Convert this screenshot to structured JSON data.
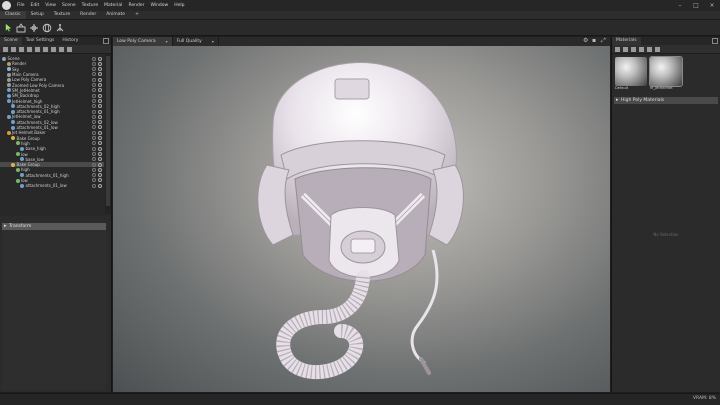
{
  "menu": [
    "File",
    "Edit",
    "View",
    "Scene",
    "Texture",
    "Material",
    "Render",
    "Window",
    "Help"
  ],
  "workspace_tabs": [
    {
      "label": "Classic",
      "active": true
    },
    {
      "label": "Setup",
      "active": false
    },
    {
      "label": "Texture",
      "active": false
    },
    {
      "label": "Render",
      "active": false
    },
    {
      "label": "Animate",
      "active": false
    },
    {
      "label": "+",
      "active": false
    }
  ],
  "left_panel": {
    "tabs": [
      {
        "label": "Scene",
        "active": true
      },
      {
        "label": "Tool Settings",
        "active": false
      },
      {
        "label": "History",
        "active": false
      }
    ],
    "tree": [
      {
        "label": "Scene",
        "indent": 0,
        "icon": "#8fa3b8"
      },
      {
        "label": "Render",
        "indent": 1,
        "icon": "#b89a6a"
      },
      {
        "label": "Sky",
        "indent": 1,
        "icon": "#8fb6d8"
      },
      {
        "label": "Main Camera",
        "indent": 1,
        "icon": "#9a9a9a"
      },
      {
        "label": "Low Poly Camera",
        "indent": 1,
        "icon": "#9a9a9a"
      },
      {
        "label": "Zoomed Low Poly Camera",
        "indent": 1,
        "icon": "#9a9a9a"
      },
      {
        "label": "SM_JetHelmet",
        "indent": 1,
        "icon": "#6fa0d0"
      },
      {
        "label": "SM_Backdrop",
        "indent": 1,
        "icon": "#6fa0d0"
      },
      {
        "label": "JetHelmet_high",
        "indent": 1,
        "icon": "#6fa0d0"
      },
      {
        "label": "attachments_02_high",
        "indent": 2,
        "icon": "#6fa0d0"
      },
      {
        "label": "attachments_01_high",
        "indent": 2,
        "icon": "#6fa0d0"
      },
      {
        "label": "JetHelmet_low",
        "indent": 1,
        "icon": "#6fa0d0"
      },
      {
        "label": "attachments_02_low",
        "indent": 2,
        "icon": "#6fa0d0"
      },
      {
        "label": "attachments_01_low",
        "indent": 2,
        "icon": "#6fa0d0"
      },
      {
        "label": "Jet Helmet Baker",
        "indent": 1,
        "icon": "#d89a3a"
      },
      {
        "label": "Bake Group",
        "indent": 2,
        "icon": "#d8b44a"
      },
      {
        "label": "high",
        "indent": 3,
        "icon": "#7ab86a"
      },
      {
        "label": "base_high",
        "indent": 4,
        "icon": "#6fa0d0"
      },
      {
        "label": "low",
        "indent": 3,
        "icon": "#7ab86a"
      },
      {
        "label": "base_low",
        "indent": 4,
        "icon": "#6fa0d0"
      },
      {
        "label": "Bake Group",
        "indent": 2,
        "icon": "#d8b44a",
        "selected": true
      },
      {
        "label": "high",
        "indent": 3,
        "icon": "#7ab86a"
      },
      {
        "label": "attachments_01_high",
        "indent": 4,
        "icon": "#6fa0d0"
      },
      {
        "label": "low",
        "indent": 3,
        "icon": "#7ab86a"
      },
      {
        "label": "attachments_01_low",
        "indent": 4,
        "icon": "#6fa0d0"
      }
    ],
    "transform_label": "Transform"
  },
  "viewport": {
    "tabs": [
      {
        "label": "Low Poly Camera",
        "active": true
      },
      {
        "label": "Full Quality",
        "active": false
      }
    ]
  },
  "right_panel": {
    "title": "Materials",
    "materials": [
      {
        "label": "Default",
        "selected": false
      },
      {
        "label": "M_JetHelmet",
        "selected": true
      }
    ],
    "section_header": "High Poly Materials",
    "empty_text": "No Selection"
  },
  "status": {
    "vram": "VRAM: 8%"
  }
}
